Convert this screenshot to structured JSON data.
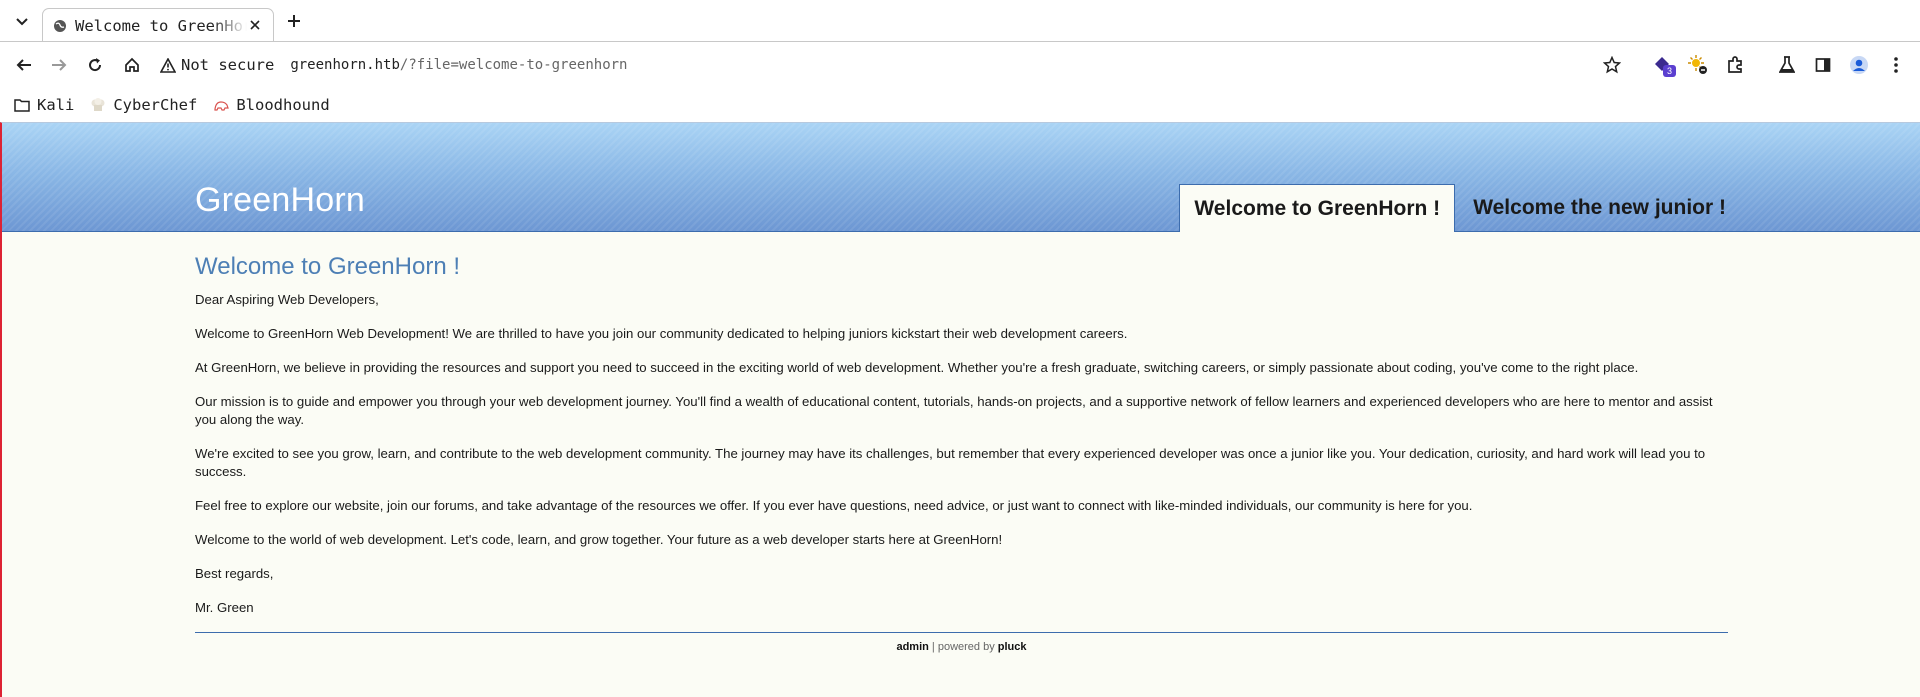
{
  "browser": {
    "tab": {
      "title": "Welcome to GreenHorn !"
    },
    "address": {
      "security_label": "Not secure",
      "host": "greenhorn.htb",
      "path": "/?file=welcome-to-greenhorn"
    },
    "extensions_badge": "3",
    "bookmarks": [
      {
        "label": "Kali",
        "icon": "folder-icon"
      },
      {
        "label": "CyberChef",
        "icon": "chef-hat-icon"
      },
      {
        "label": "Bloodhound",
        "icon": "bloodhound-icon"
      }
    ]
  },
  "site": {
    "title": "GreenHorn",
    "nav": [
      {
        "label": "Welcome to GreenHorn !",
        "active": true
      },
      {
        "label": "Welcome the new junior !",
        "active": false
      }
    ]
  },
  "article": {
    "heading": "Welcome to GreenHorn !",
    "paragraphs": [
      "Dear Aspiring Web Developers,",
      "Welcome to GreenHorn Web Development! We are thrilled to have you join our community dedicated to helping juniors kickstart their web development careers.",
      "At GreenHorn, we believe in providing the resources and support you need to succeed in the exciting world of web development. Whether you're a fresh graduate, switching careers, or simply passionate about coding, you've come to the right place.",
      "Our mission is to guide and empower you through your web development journey. You'll find a wealth of educational content, tutorials, hands-on projects, and a supportive network of fellow learners and experienced developers who are here to mentor and assist you along the way.",
      "We're excited to see you grow, learn, and contribute to the web development community. The journey may have its challenges, but remember that every experienced developer was once a junior like you. Your dedication, curiosity, and hard work will lead you to success.",
      "Feel free to explore our website, join our forums, and take advantage of the resources we offer. If you ever have questions, need advice, or just want to connect with like-minded individuals, our community is here for you.",
      "Welcome to the world of web development. Let's code, learn, and grow together. Your future as a web developer starts here at GreenHorn!",
      "Best regards,",
      "Mr. Green"
    ]
  },
  "footer": {
    "admin_link": "admin",
    "separator": " | powered by ",
    "pluck_link": "pluck"
  },
  "colors": {
    "header_top": "#aad4f5",
    "header_bottom": "#6d97d3",
    "heading": "#4d7fb5",
    "page_bg": "#fbfcf5",
    "rule": "#3c6cad"
  }
}
